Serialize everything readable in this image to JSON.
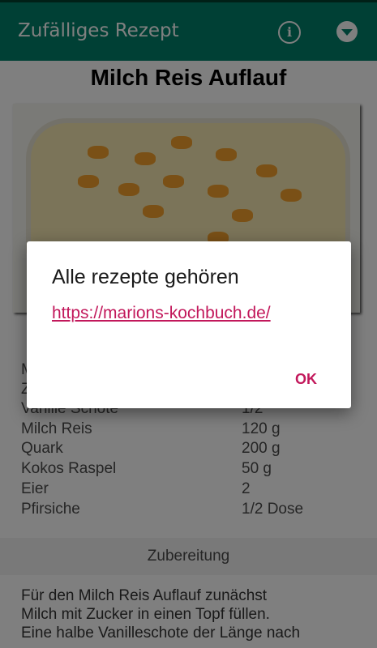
{
  "appbar": {
    "title": "Zufälliges Rezept",
    "info_icon": "info-circle-icon",
    "menu_icon": "chevron-down-circle-icon",
    "color": "#00806a"
  },
  "recipe": {
    "title": "Milch Reis Auflauf",
    "image": "baked-rice-pudding-with-peaches",
    "ingredients": [
      {
        "name": "M",
        "qty": ""
      },
      {
        "name": "Z",
        "qty": ""
      },
      {
        "name": "Vanille Schote",
        "qty": "1/2"
      },
      {
        "name": "Milch Reis",
        "qty": "120 g"
      },
      {
        "name": "Quark",
        "qty": "200 g"
      },
      {
        "name": "Kokos Raspel",
        "qty": "50 g"
      },
      {
        "name": "Eier",
        "qty": "2"
      },
      {
        "name": "Pfirsiche",
        "qty": "1/2 Dose"
      }
    ],
    "section_label": "Zubereitung",
    "instructions": [
      "Für den Milch Reis Auflauf zunächst",
      "Milch mit Zucker in einen Topf füllen.",
      "Eine halbe Vanilleschote der Länge nach"
    ]
  },
  "dialog": {
    "title": "Alle rezepte gehören",
    "link": "https://marions-kochbuch.de/",
    "ok_label": "OK",
    "accent": "#c2185b"
  }
}
